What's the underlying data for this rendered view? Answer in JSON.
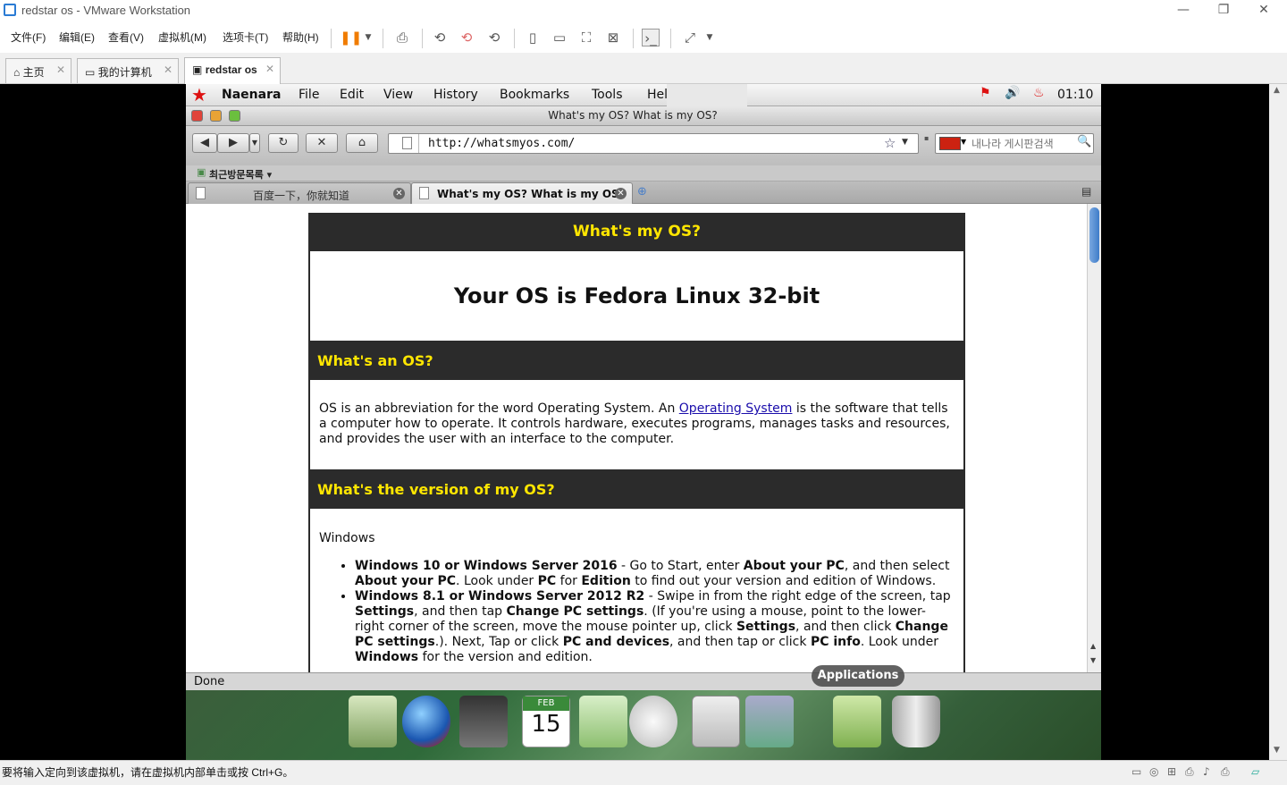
{
  "vmware": {
    "title": "redstar os - VMware Workstation",
    "menus": [
      "文件(F)",
      "编辑(E)",
      "查看(V)",
      "虚拟机(M)",
      "选项卡(T)",
      "帮助(H)"
    ],
    "tabs": [
      {
        "label": "主页"
      },
      {
        "label": "我的计算机"
      },
      {
        "label": "redstar os"
      }
    ],
    "status_message": "要将输入定向到该虚拟机，请在虚拟机内部单击或按 Ctrl+G。"
  },
  "guest": {
    "menubar": {
      "app_name": "Naenara",
      "menus": [
        "File",
        "Edit",
        "View",
        "History",
        "Bookmarks",
        "Tools",
        "Hel"
      ],
      "clock": "01:10"
    },
    "window_title": "What's my OS? What is my OS?",
    "url": "http://whatsmyos.com/",
    "search_placeholder": "내나라 게시판검색",
    "bookmarks_label": "최근방문목록",
    "tabs": [
      {
        "label": "百度一下，你就知道",
        "active": false
      },
      {
        "label": "What's my OS? What is my OS?",
        "active": true
      }
    ],
    "status": "Done",
    "dock_tooltip": "Applications",
    "calendar": {
      "month": "FEB",
      "day": "15"
    }
  },
  "webpage": {
    "header": "What's my OS?",
    "result": "Your OS is Fedora Linux 32-bit",
    "section1": {
      "title": "What's an OS?",
      "text_before": "OS is an abbreviation for the word Operating System. An ",
      "link": "Operating System",
      "text_after": " is the software that tells a computer how to operate. It controls hardware, executes programs, manages tasks and resources, and provides the user with an interface to the computer."
    },
    "section2": {
      "title": "What's the version of my OS?",
      "subtitle": "Windows",
      "items": [
        {
          "b1": "Windows 10 or Windows Server 2016",
          "t1": " - Go to Start, enter ",
          "b2": "About your PC",
          "t2": ", and then select ",
          "b3": "About your PC",
          "t3": ". Look under ",
          "b4": "PC",
          "t4": " for ",
          "b5": "Edition",
          "t5": " to find out your version and edition of Windows."
        },
        {
          "b1": "Windows 8.1 or Windows Server 2012 R2",
          "t1": " - Swipe in from the right edge of the screen, tap ",
          "b2": "Settings",
          "t2": ", and then tap ",
          "b3": "Change PC settings",
          "t3": ". (If you're using a mouse, point to the lower-right corner of the screen, move the mouse pointer up, click ",
          "b4": "Settings",
          "t4": ", and then click ",
          "b5": "Change PC settings",
          "t5": ".). Next, Tap or click ",
          "b6": "PC and devices",
          "t6": ", and then tap or click ",
          "b7": "PC info",
          "t7": ". Look under ",
          "b8": "Windows",
          "t8": " for the version and edition."
        }
      ]
    }
  },
  "colors": {
    "header_bg": "#2b2b2b",
    "header_text": "#ffe600",
    "link": "#1a0dab"
  }
}
